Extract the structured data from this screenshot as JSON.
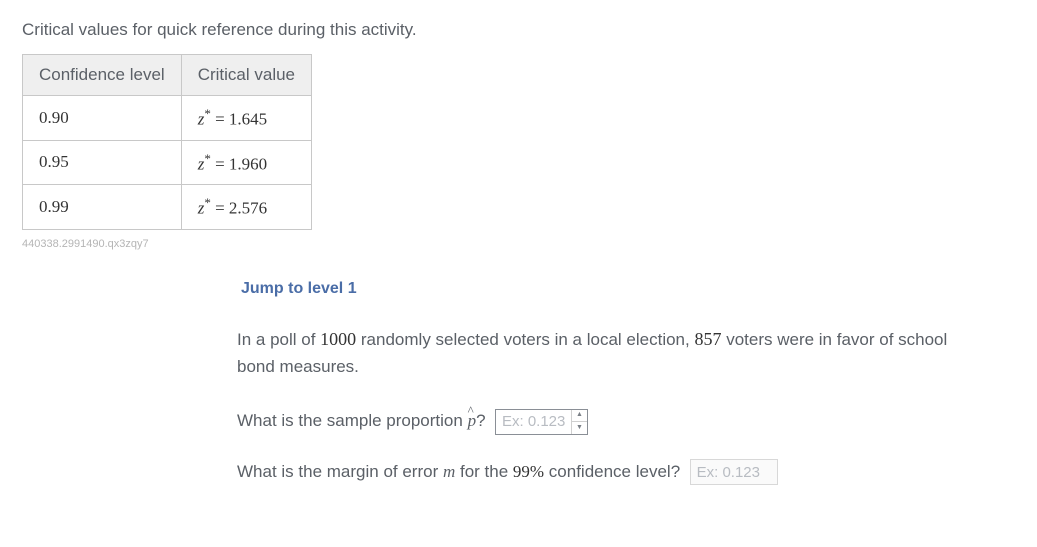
{
  "intro": "Critical values for quick reference during this activity.",
  "table": {
    "headers": {
      "conf": "Confidence level",
      "crit": "Critical value"
    },
    "rows": [
      {
        "conf": "0.90",
        "z": "1.645"
      },
      {
        "conf": "0.95",
        "z": "1.960"
      },
      {
        "conf": "0.99",
        "z": "2.576"
      }
    ]
  },
  "footprint": "440338.2991490.qx3zqy7",
  "jump_link": "Jump to level 1",
  "problem": {
    "pre1": "In a poll of ",
    "n": "1000",
    "mid1": " randomly selected voters in a local election, ",
    "k": "857",
    "post1": " voters were in favor of school bond measures."
  },
  "q1": {
    "text_before": "What is the sample proportion ",
    "text_after": "?",
    "placeholder": "Ex: 0.123"
  },
  "q2": {
    "text_before": "What is the margin of error ",
    "text_mid": " for the ",
    "conf_pct": "99%",
    "text_after": " confidence level?",
    "placeholder": "Ex: 0.123"
  },
  "zvar": "z",
  "star": "*",
  "eqsign": " = "
}
